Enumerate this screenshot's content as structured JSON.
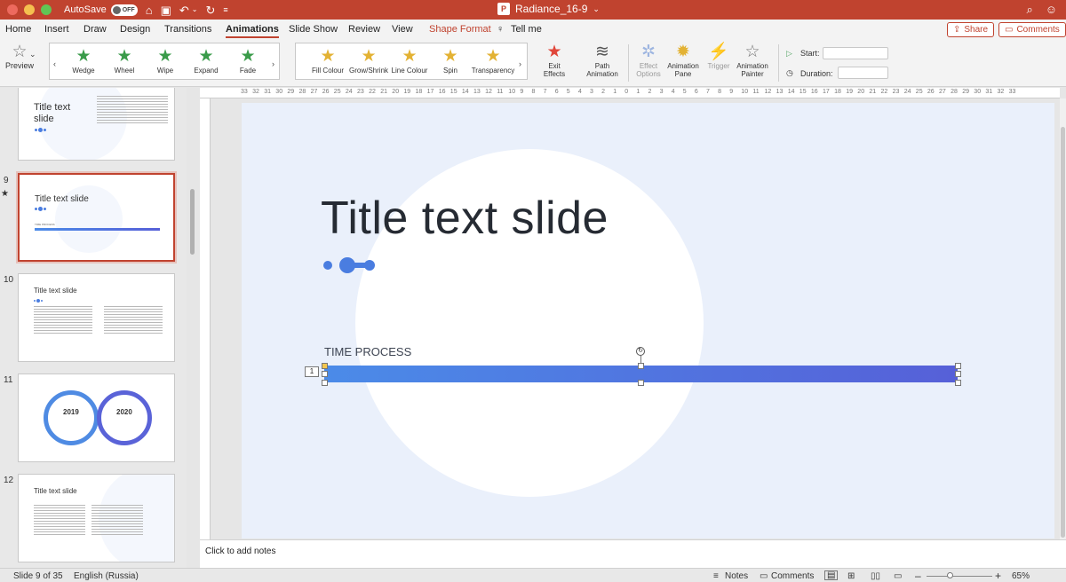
{
  "window": {
    "autosave_label": "AutoSave",
    "autosave_state": "OFF",
    "doc_title": "Radiance_16-9",
    "doc_icon": "P"
  },
  "menu": {
    "tabs": [
      "Home",
      "Insert",
      "Draw",
      "Design",
      "Transitions",
      "Animations",
      "Slide Show",
      "Review",
      "View",
      "Shape Format",
      "Tell me"
    ],
    "active": "Animations",
    "share": "Share",
    "comments": "Comments"
  },
  "ribbon": {
    "preview": "Preview",
    "entrance_effects": [
      "Wedge",
      "Wheel",
      "Wipe",
      "Expand",
      "Fade"
    ],
    "emphasis_effects": [
      "Fill Colour",
      "Grow/Shrink",
      "Line Colour",
      "Spin",
      "Transparency"
    ],
    "exit_effects": "Exit Effects",
    "path_animation": "Path Animation",
    "effect_options": "Effect Options",
    "animation_pane": "Animation Pane",
    "trigger": "Trigger",
    "animation_painter": "Animation Painter",
    "start_label": "Start:",
    "duration_label": "Duration:"
  },
  "thumbnails": [
    {
      "num": "",
      "title": "Title text slide",
      "kind": "text-circle"
    },
    {
      "num": "9",
      "title": "Title text slide",
      "kind": "progress",
      "selected": true,
      "sub": "TIME PROCESS"
    },
    {
      "num": "10",
      "title": "Title text slide",
      "kind": "two-column"
    },
    {
      "num": "11",
      "title": "",
      "kind": "cycle",
      "years": [
        "2019",
        "2020"
      ]
    },
    {
      "num": "12",
      "title": "Title text slide",
      "kind": "two-column-circle"
    }
  ],
  "slide": {
    "title": "Title text slide",
    "progress_label": "TIME PROCESS",
    "animation_order": "1"
  },
  "ruler": {
    "h_labels": [
      "33",
      "32",
      "31",
      "30",
      "29",
      "28",
      "27",
      "26",
      "25",
      "24",
      "23",
      "22",
      "21",
      "20",
      "19",
      "18",
      "17",
      "16",
      "15",
      "14",
      "13",
      "12",
      "11",
      "10",
      "9",
      "8",
      "7",
      "6",
      "5",
      "4",
      "3",
      "2",
      "1",
      "0",
      "1",
      "2",
      "3",
      "4",
      "5",
      "6",
      "7",
      "8",
      "9",
      "10",
      "11",
      "12",
      "13",
      "14",
      "15",
      "16",
      "17",
      "18",
      "19",
      "20",
      "21",
      "22",
      "23",
      "24",
      "25",
      "26",
      "27",
      "28",
      "29",
      "30",
      "31",
      "32",
      "33"
    ]
  },
  "notes": {
    "placeholder": "Click to add notes"
  },
  "status": {
    "slide_info": "Slide 9 of 35",
    "language": "English (Russia)",
    "notes": "Notes",
    "comments": "Comments",
    "zoom": "65%"
  },
  "colors": {
    "accent": "#c0432f",
    "bar_start": "#4b8be8",
    "bar_end": "#5660d8",
    "slide_bg": "#eaf0fb"
  }
}
